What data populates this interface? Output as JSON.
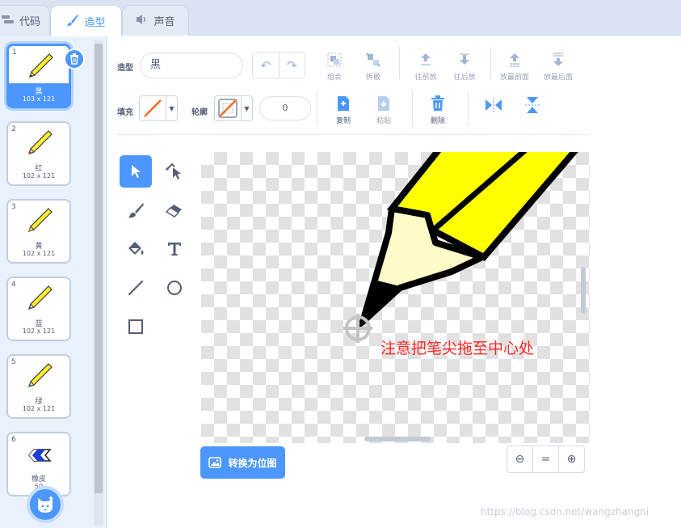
{
  "tabs": [
    {
      "label": "代码",
      "icon": "code-blocks-icon"
    },
    {
      "label": "造型",
      "icon": "paintbrush-icon"
    },
    {
      "label": "声音",
      "icon": "speaker-icon"
    }
  ],
  "costumes": [
    {
      "num": "1",
      "name": "黑",
      "size": "103 x 121",
      "icon": "pencil-icon"
    },
    {
      "num": "2",
      "name": "红",
      "size": "102 x 121",
      "icon": "pencil-icon"
    },
    {
      "num": "3",
      "name": "黄",
      "size": "102 x 121",
      "icon": "pencil-icon"
    },
    {
      "num": "4",
      "name": "蓝",
      "size": "102 x 121",
      "icon": "pencil-icon"
    },
    {
      "num": "5",
      "name": "绿",
      "size": "102 x 121",
      "icon": "pencil-icon"
    },
    {
      "num": "6",
      "name": "橡皮",
      "size": "50",
      "icon": "eraser-icon"
    }
  ],
  "toolbar": {
    "costume_label": "造型",
    "costume_name": "黑",
    "group": "组合",
    "ungroup": "拆散",
    "forward": "往前放",
    "backward": "往后放",
    "front": "放最前面",
    "back": "放最后面",
    "fill_label": "填充",
    "outline_label": "轮廓",
    "outline_width": "0",
    "copy": "复制",
    "paste": "粘贴",
    "delete": "删除"
  },
  "canvas": {
    "annotation": "注意把笔尖拖至中心处"
  },
  "convert_button": "转换为位图",
  "watermark": "https://blog.csdn.net/wangzhangni",
  "colors": {
    "accent": "#4c97ff",
    "annotation": "#ff2a2a",
    "pencil_yellow": "#ffff00"
  }
}
